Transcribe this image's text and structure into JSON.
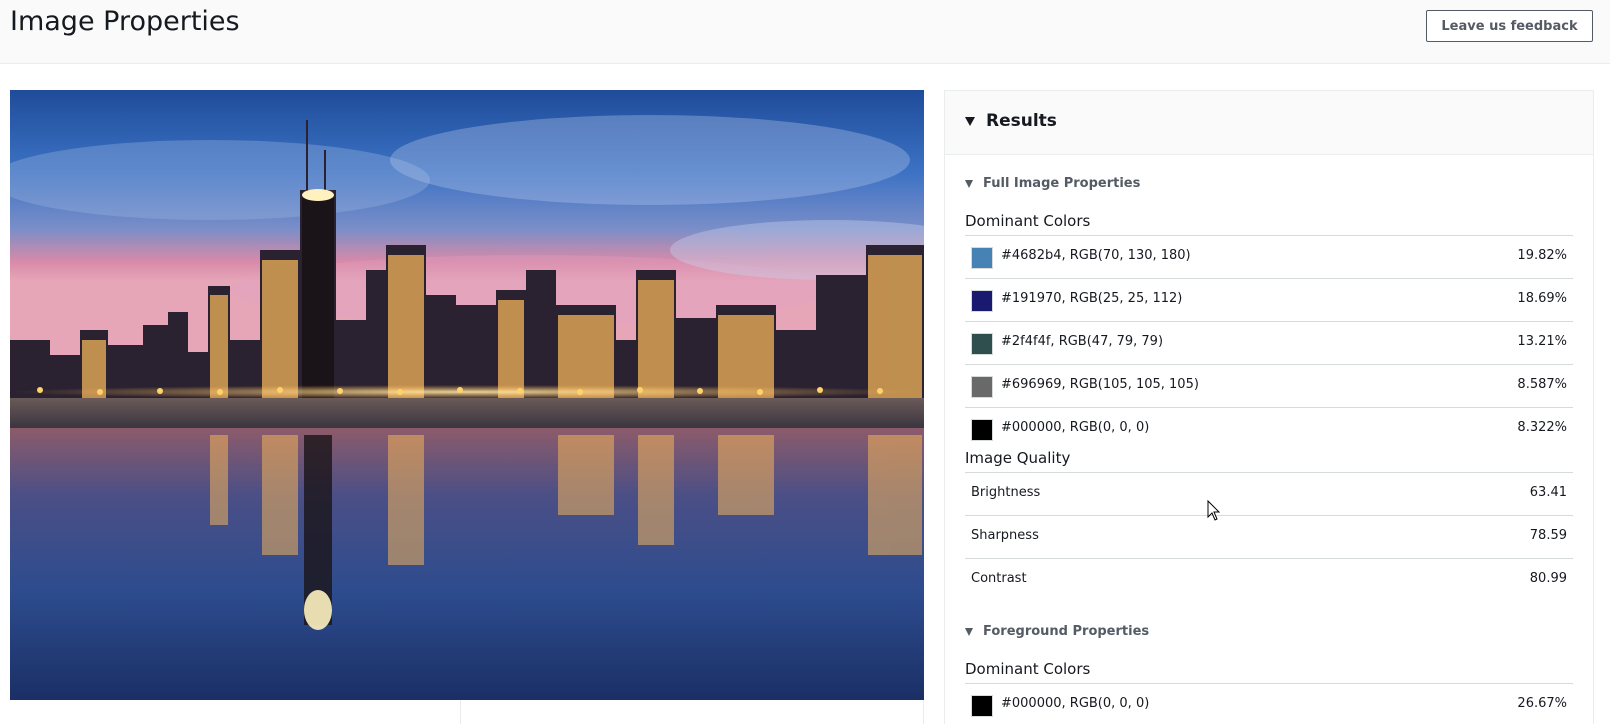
{
  "header": {
    "title": "Image Properties",
    "feedback_label": "Leave us feedback"
  },
  "image": {
    "alt": "City skyline at dusk reflected in water"
  },
  "results": {
    "title": "Results",
    "full_image": {
      "title": "Full Image Properties",
      "dominant_colors_label": "Dominant Colors",
      "dominant_colors": [
        {
          "hex": "#4682b4",
          "label": "#4682b4, RGB(70, 130, 180)",
          "percent": "19.82%"
        },
        {
          "hex": "#191970",
          "label": "#191970, RGB(25, 25, 112)",
          "percent": "18.69%"
        },
        {
          "hex": "#2f4f4f",
          "label": "#2f4f4f, RGB(47, 79, 79)",
          "percent": "13.21%"
        },
        {
          "hex": "#696969",
          "label": "#696969, RGB(105, 105, 105)",
          "percent": "8.587%"
        },
        {
          "hex": "#000000",
          "label": "#000000, RGB(0, 0, 0)",
          "percent": "8.322%"
        }
      ],
      "image_quality_label": "Image Quality",
      "image_quality": [
        {
          "label": "Brightness",
          "value": "63.41"
        },
        {
          "label": "Sharpness",
          "value": "78.59"
        },
        {
          "label": "Contrast",
          "value": "80.99"
        }
      ]
    },
    "foreground": {
      "title": "Foreground Properties",
      "dominant_colors_label": "Dominant Colors",
      "dominant_colors": [
        {
          "hex": "#000000",
          "label": "#000000, RGB(0, 0, 0)",
          "percent": "26.67%"
        }
      ]
    }
  }
}
